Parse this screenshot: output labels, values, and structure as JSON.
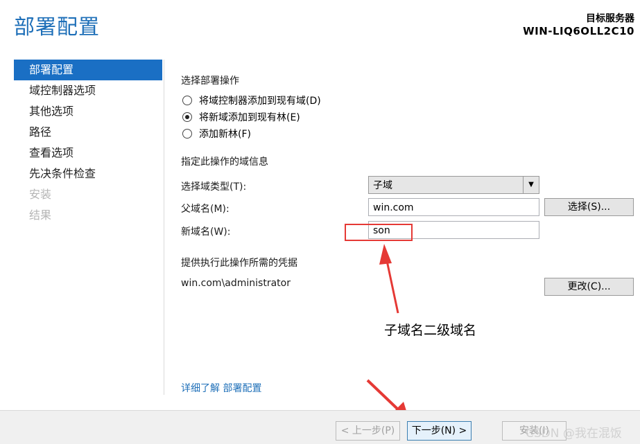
{
  "page": {
    "title": "部署配置"
  },
  "target_server": {
    "label": "目标服务器",
    "name": "WIN-LIQ6OLL2C10"
  },
  "sidebar": {
    "items": [
      {
        "label": "部署配置",
        "state": "active"
      },
      {
        "label": "域控制器选项",
        "state": "normal"
      },
      {
        "label": "其他选项",
        "state": "normal"
      },
      {
        "label": "路径",
        "state": "normal"
      },
      {
        "label": "查看选项",
        "state": "normal"
      },
      {
        "label": "先决条件检查",
        "state": "normal"
      },
      {
        "label": "安装",
        "state": "disabled"
      },
      {
        "label": "结果",
        "state": "disabled"
      }
    ]
  },
  "deploy": {
    "heading": "选择部署操作",
    "options": [
      {
        "label": "将域控制器添加到现有域(D)",
        "checked": false
      },
      {
        "label": "将新域添加到现有林(E)",
        "checked": true
      },
      {
        "label": "添加新林(F)",
        "checked": false
      }
    ]
  },
  "domain_info": {
    "heading": "指定此操作的域信息",
    "type_label": "选择域类型(T):",
    "type_value": "子域",
    "parent_label": "父域名(M):",
    "parent_value": "win.com",
    "select_button": "选择(S)...",
    "new_label": "新域名(W):",
    "new_value": "son"
  },
  "credentials": {
    "heading": "提供执行此操作所需的凭据",
    "value": "win.com\\administrator",
    "change_button": "更改(C)..."
  },
  "learn_more": "详细了解 部署配置",
  "annotation": "子域名二级域名",
  "footer": {
    "prev": "< 上一步(P)",
    "next": "下一步(N) >",
    "install": "安装(I)"
  },
  "watermark": "CSDN @我在混饭",
  "colors": {
    "accent": "#1a6fc4",
    "annotation_red": "#e53935"
  }
}
